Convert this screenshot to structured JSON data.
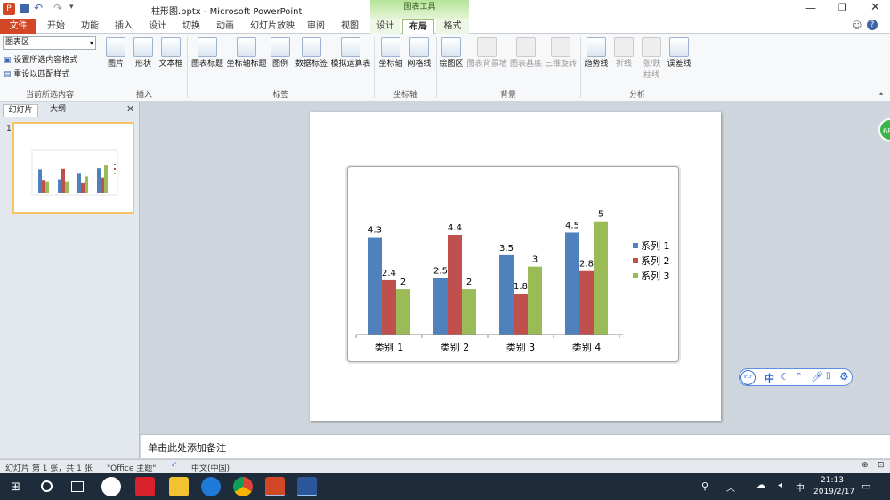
{
  "titlebar": {
    "title": "柱形图.pptx - Microsoft PowerPoint",
    "context_group": "图表工具"
  },
  "tabs": [
    "文件",
    "开始",
    "功能",
    "插入",
    "设计",
    "切换",
    "动画",
    "幻灯片放映",
    "审阅",
    "视图"
  ],
  "context_tabs": [
    "设计",
    "布局",
    "格式"
  ],
  "active_tab": "布局",
  "ribbon": {
    "selection": {
      "dropdown_value": "图表区",
      "format_selection": "设置所选内容格式",
      "reset_style": "重设以匹配样式",
      "label": "当前所选内容"
    },
    "insert": {
      "picture": "图片",
      "shapes": "形状",
      "textbox": "文本框",
      "label": "插入"
    },
    "labels": {
      "chart_title": "图表标题",
      "axis_titles": "坐标轴标题",
      "legend": "图例",
      "data_labels": "数据标签",
      "data_table": "模拟运算表",
      "label": "标签"
    },
    "axes": {
      "axes": "坐标轴",
      "gridlines": "网格线",
      "label": "坐标轴"
    },
    "background": {
      "plot_area": "绘图区",
      "chart_wall": "图表背景墙",
      "chart_floor": "图表基底",
      "rotation": "三维旋转",
      "label": "背景"
    },
    "analysis": {
      "trendline": "趋势线",
      "lines": "折线",
      "updown1": "涨/跌",
      "updown2": "柱线",
      "error_bars": "误差线",
      "label": "分析"
    }
  },
  "left_pane": {
    "tab_slides": "幻灯片",
    "tab_outline": "大纲",
    "slide_number": "1"
  },
  "notes": {
    "placeholder": "单击此处添加备注"
  },
  "status": {
    "slide_info": "幻灯片 第 1 张，共 1 张",
    "theme": "\"Office 主题\"",
    "language": "中文(中国)"
  },
  "ime": {
    "label": "iFLY",
    "mode": "中"
  },
  "side_badge": "68",
  "taskbar": {
    "time": "21:13",
    "date": "2019/2/17"
  },
  "chart_data": {
    "type": "bar",
    "categories": [
      "类别 1",
      "类别 2",
      "类别 3",
      "类别 4"
    ],
    "series": [
      {
        "name": "系列 1",
        "values": [
          4.3,
          2.5,
          3.5,
          4.5
        ],
        "color": "#4f81bd"
      },
      {
        "name": "系列 2",
        "values": [
          2.4,
          4.4,
          1.8,
          2.8
        ],
        "color": "#c0504d"
      },
      {
        "name": "系列 3",
        "values": [
          2,
          2,
          3,
          5
        ],
        "color": "#9bbb59"
      }
    ],
    "ylim": [
      0,
      5.5
    ],
    "legend": "right",
    "data_labels": true
  }
}
